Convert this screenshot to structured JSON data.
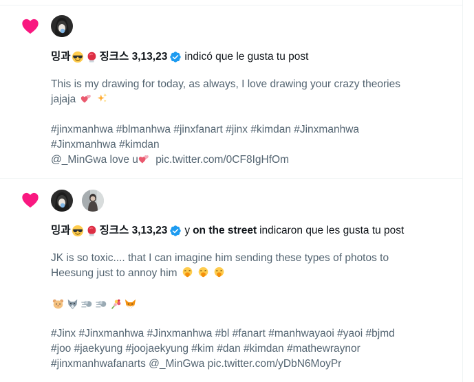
{
  "colors": {
    "heart": "#f91880",
    "verified": "#1d9bf0",
    "text_secondary": "#536471",
    "text_primary": "#0f1419",
    "divider": "#eff3f4"
  },
  "notifications": [
    {
      "user_name": "밍과",
      "user_suffix": "징크스 3,13,23",
      "connector": "",
      "other_user": "",
      "action": "indicó que le gusta tu post",
      "lines": [
        "This is my drawing for today, as always, I love drawing your crazy theories",
        "jajaja",
        "#jinxmanhwa #blmanhwa #jinxfanart #jinx #kimdan #Jinxmanhwa",
        "#Jinxmanhwa #kimdan",
        "@_MinGwa love u",
        "pic.twitter.com/0CF8IgHfOm"
      ]
    },
    {
      "user_name": "밍과",
      "user_suffix": "징크스 3,13,23",
      "connector": "y",
      "other_user": "on the street",
      "action": "indicaron que les gusta tu post",
      "lines": [
        "JK is so toxic.... that I can imagine him sending these types of photos to",
        "Heesung just to annoy him",
        "#Jinx #Jinxmanhwa #Jinxmanhwa #bl #fanart #manhwayaoi #yaoi #bjmd",
        "#joo #jaekyung #joojaekyung #kim #dan #kimdan #mathewraynor",
        "#jinxmanhwafanarts @_MinGwa pic.twitter.com/yDbN6MoyPr"
      ]
    }
  ]
}
